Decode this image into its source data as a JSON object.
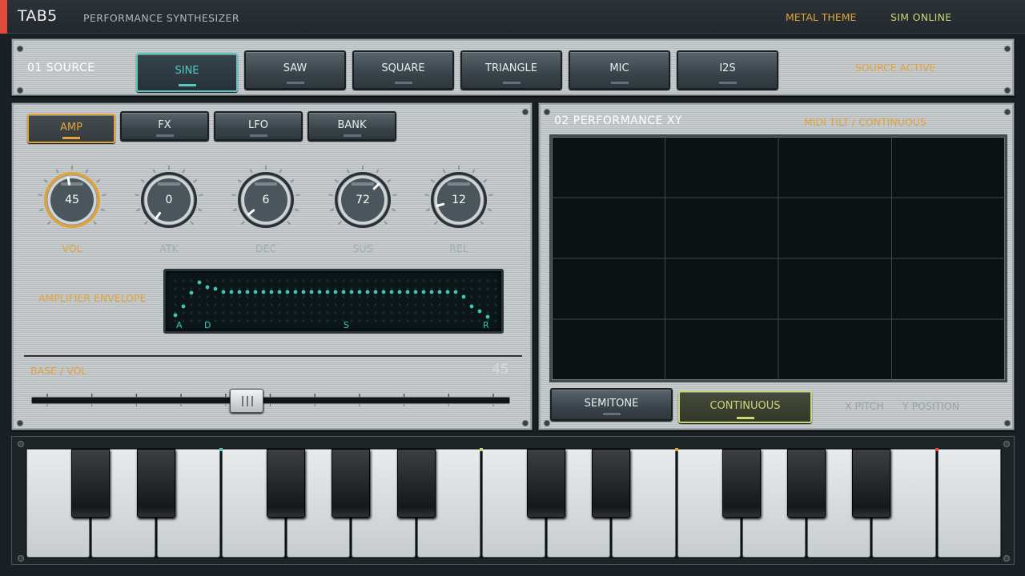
{
  "topbar": {
    "brand": "TAB5",
    "subtitle": "PERFORMANCE SYNTHESIZER",
    "theme": "METAL THEME",
    "sim": "SIM  ONLINE",
    "colors": {
      "accent": "#e0a33a",
      "red": "#e04a3a",
      "online": "#c8d77a"
    }
  },
  "source": {
    "title": "01  SOURCE",
    "status": "SOURCE ACTIVE",
    "selected": "SINE",
    "buttons": [
      "SINE",
      "SAW",
      "SQUARE",
      "TRIANGLE",
      "MIC",
      "I2S"
    ]
  },
  "tabs": {
    "selected": "AMP",
    "items": [
      "AMP",
      "FX",
      "LFO",
      "BANK"
    ]
  },
  "knobs": [
    {
      "label": "VOL",
      "value": "45",
      "active": true
    },
    {
      "label": "ATK",
      "value": "0"
    },
    {
      "label": "DEC",
      "value": "6"
    },
    {
      "label": "SUS",
      "value": "72"
    },
    {
      "label": "REL",
      "value": "12"
    }
  ],
  "envelope": {
    "label": "AMPLIFIER ENVELOPE",
    "markers": [
      "A",
      "D",
      "S",
      "R"
    ],
    "color": "#3cc8b4"
  },
  "slider": {
    "label": "BASE  /  VOL",
    "value": "45",
    "position": 0.45
  },
  "xy": {
    "title": "02  PERFORMANCE XY",
    "mode_text": "MIDI TILT  /  CONTINUOUS",
    "buttons": [
      "SEMITONE",
      "CONTINUOUS"
    ],
    "selected": "CONTINUOUS",
    "footer_left": "X PITCH",
    "footer_right": "Y POSITION"
  },
  "keyboard": {
    "white_keys": 15,
    "black_keys": 10,
    "marker_colors": [
      "#5ac7c0",
      "#c8d77a",
      "#e0a33a",
      "#e04a3a"
    ]
  }
}
